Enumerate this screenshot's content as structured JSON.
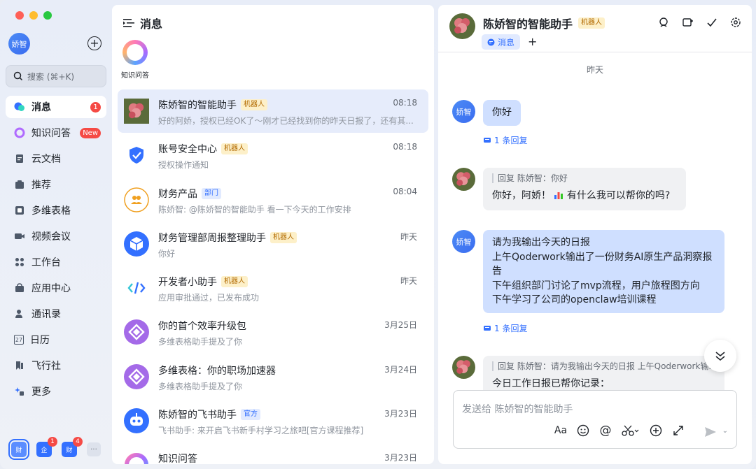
{
  "app": {
    "me_avatar": "娇智"
  },
  "sidebar": {
    "search_placeholder": "搜索 (⌘+K)",
    "items": [
      {
        "label": "消息",
        "icon": "chat-bubble-icon",
        "badge": "1"
      },
      {
        "label": "知识问答",
        "icon": "knowledge-ring-icon",
        "badge": "New"
      },
      {
        "label": "云文档",
        "icon": "document-icon"
      },
      {
        "label": "推荐",
        "icon": "recommend-icon"
      },
      {
        "label": "多维表格",
        "icon": "base-table-icon"
      },
      {
        "label": "视频会议",
        "icon": "video-camera-icon"
      },
      {
        "label": "工作台",
        "icon": "workspace-grid-icon"
      },
      {
        "label": "应用中心",
        "icon": "app-center-icon"
      },
      {
        "label": "通讯录",
        "icon": "contacts-icon"
      },
      {
        "label": "日历",
        "icon": "calendar-icon",
        "day": "27"
      },
      {
        "label": "飞行社",
        "icon": "bookmark-icon"
      },
      {
        "label": "更多",
        "icon": "more-stars-icon"
      }
    ],
    "bottom_apps": [
      {
        "label": "财",
        "badge": ""
      },
      {
        "label": "企",
        "badge": "1"
      },
      {
        "label": "财",
        "badge": "4"
      },
      {
        "label": "···",
        "badge": ""
      }
    ]
  },
  "list": {
    "title": "消息",
    "shortcut_label": "知识问答",
    "conversations": [
      {
        "title": "陈娇智的智能助手",
        "tag": "机器人",
        "tag_type": "bot",
        "time": "08:18",
        "preview": "好的阿娇，授权已经OK了～刚才已经找到你的昨天日报了，还有其...",
        "avatar": "flower",
        "active": true
      },
      {
        "title": "账号安全中心",
        "tag": "机器人",
        "tag_type": "bot",
        "time": "08:18",
        "preview": "授权操作通知",
        "avatar": "shield"
      },
      {
        "title": "财务产品",
        "tag": "部门",
        "tag_type": "dept",
        "time": "08:04",
        "preview": "陈娇智: @陈娇智的智能助手 看一下今天的工作安排",
        "avatar": "group"
      },
      {
        "title": "财务管理部周报整理助手",
        "tag": "机器人",
        "tag_type": "bot",
        "time": "昨天",
        "preview": "你好",
        "avatar": "cube"
      },
      {
        "title": "开发者小助手",
        "tag": "机器人",
        "tag_type": "bot",
        "time": "昨天",
        "preview": "应用审批通过，已发布成功",
        "avatar": "code"
      },
      {
        "title": "你的首个效率升级包",
        "tag": "",
        "tag_type": "",
        "time": "3月25日",
        "preview": "多维表格助手提及了你",
        "avatar": "base"
      },
      {
        "title": "多维表格：你的职场加速器",
        "tag": "",
        "tag_type": "",
        "time": "3月24日",
        "preview": "多维表格助手提及了你",
        "avatar": "base"
      },
      {
        "title": "陈娇智的飞书助手",
        "tag": "官方",
        "tag_type": "off",
        "time": "3月23日",
        "preview": "飞书助手: 来开启飞书新手村学习之旅吧[官方课程推荐]",
        "avatar": "robot"
      },
      {
        "title": "知识问答",
        "tag": "",
        "tag_type": "",
        "time": "3月23日",
        "preview": "",
        "avatar": "ring"
      }
    ]
  },
  "chat": {
    "title": "陈娇智的智能助手",
    "title_tag": "机器人",
    "tab_label": "消息",
    "date_divider": "昨天",
    "messages": {
      "m1": "你好",
      "m1_reply": "1 条回复",
      "m2_quote": "回复 陈娇智：你好",
      "m2_text_a": "你好，阿娇！",
      "m2_text_b": "有什么我可以帮你的吗?",
      "m3_lines": [
        "请为我输出今天的日报",
        "上午Qoderwork输出了一份财务AI原生产品洞察报",
        "告",
        "下午组织部门讨论了mvp流程，用户旅程图方向",
        "下午学习了公司的openclaw培训课程"
      ],
      "m3_reply": "1 条回复",
      "m4_quote": "回复 陈娇智：请为我输出今天的日报 上午Qoderwork输...",
      "m4_text": "今日工作日报已帮你记录："
    },
    "me_avatar": "娇智",
    "composer_placeholder": "发送给 陈娇智的智能助手"
  },
  "colors": {
    "accent": "#3370ff",
    "badge": "#f54a45",
    "bubble_me": "#cfdfff",
    "bubble_bot": "#f0f1f3"
  }
}
